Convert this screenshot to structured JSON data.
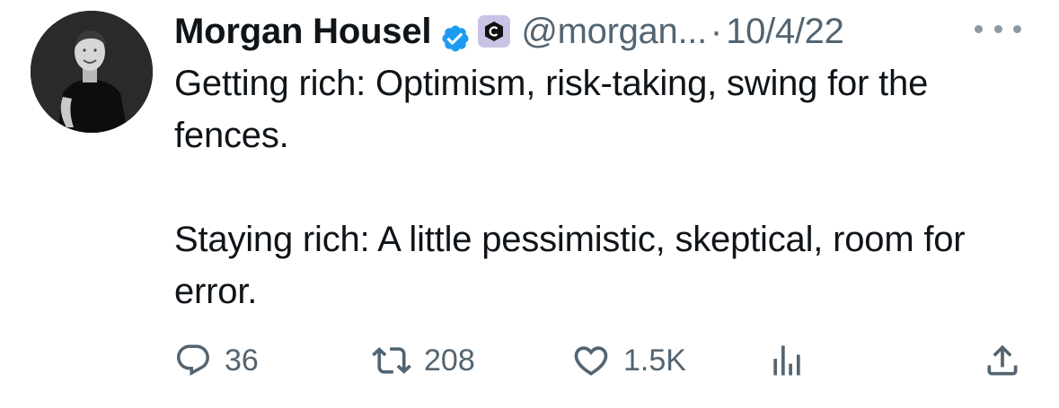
{
  "tweet": {
    "author": {
      "name": "Morgan Housel",
      "handle": "@morgan...",
      "verified_color": "#1d9bf0",
      "affiliate_badge_color": "#c9c3e6"
    },
    "separator": "·",
    "date": "10/4/22",
    "more_icon": "ellipsis-icon",
    "text": {
      "line1": "Getting rich: Optimism, risk-taking, swing for the fences.",
      "line2": "Staying rich: A little pessimistic, skeptical, room for error."
    },
    "actions": {
      "replies": "36",
      "retweets": "208",
      "likes": "1.5K",
      "views_icon": "analytics-icon",
      "share_icon": "share-icon"
    }
  }
}
